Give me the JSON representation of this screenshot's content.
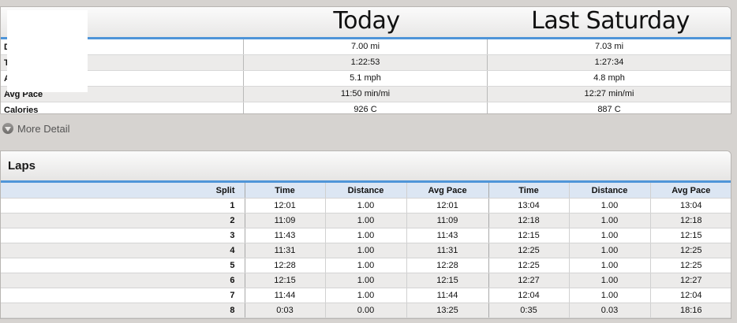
{
  "summary": {
    "headers": [
      "Today",
      "Last Saturday"
    ],
    "rows": [
      {
        "label": "D",
        "today": "7.00 mi",
        "last": "7.03 mi"
      },
      {
        "label": "T",
        "today": "1:22:53",
        "last": "1:27:34"
      },
      {
        "label": "A",
        "today": "5.1 mph",
        "last": "4.8 mph"
      },
      {
        "label": "Avg Pace",
        "today": "11:50 min/mi",
        "last": "12:27 min/mi"
      },
      {
        "label": "Calories",
        "today": "926 C",
        "last": "887 C"
      }
    ]
  },
  "more_detail": {
    "label": "More Detail"
  },
  "laps": {
    "title": "Laps",
    "columns": [
      "Split",
      "Time",
      "Distance",
      "Avg Pace",
      "Time",
      "Distance",
      "Avg Pace"
    ],
    "rows": [
      [
        "1",
        "12:01",
        "1.00",
        "12:01",
        "13:04",
        "1.00",
        "13:04"
      ],
      [
        "2",
        "11:09",
        "1.00",
        "11:09",
        "12:18",
        "1.00",
        "12:18"
      ],
      [
        "3",
        "11:43",
        "1.00",
        "11:43",
        "12:15",
        "1.00",
        "12:15"
      ],
      [
        "4",
        "11:31",
        "1.00",
        "11:31",
        "12:25",
        "1.00",
        "12:25"
      ],
      [
        "5",
        "12:28",
        "1.00",
        "12:28",
        "12:25",
        "1.00",
        "12:25"
      ],
      [
        "6",
        "12:15",
        "1.00",
        "12:15",
        "12:27",
        "1.00",
        "12:27"
      ],
      [
        "7",
        "11:44",
        "1.00",
        "11:44",
        "12:04",
        "1.00",
        "12:04"
      ],
      [
        "8",
        "0:03",
        "0.00",
        "13:25",
        "0:35",
        "0.03",
        "18:16"
      ]
    ]
  },
  "colors": {
    "accent": "#4f95d8",
    "header_row": "#dce6f3",
    "stripe": "#ecebea"
  }
}
